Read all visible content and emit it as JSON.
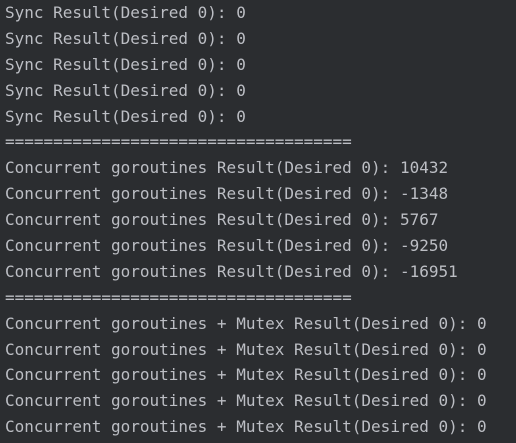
{
  "console": {
    "lines": [
      "Sync Result(Desired 0): 0",
      "Sync Result(Desired 0): 0",
      "Sync Result(Desired 0): 0",
      "Sync Result(Desired 0): 0",
      "Sync Result(Desired 0): 0",
      "====================================",
      "Concurrent goroutines Result(Desired 0): 10432",
      "Concurrent goroutines Result(Desired 0): -1348",
      "Concurrent goroutines Result(Desired 0): 5767",
      "Concurrent goroutines Result(Desired 0): -9250",
      "Concurrent goroutines Result(Desired 0): -16951",
      "====================================",
      "Concurrent goroutines + Mutex Result(Desired 0): 0",
      "Concurrent goroutines + Mutex Result(Desired 0): 0",
      "Concurrent goroutines + Mutex Result(Desired 0): 0",
      "Concurrent goroutines + Mutex Result(Desired 0): 0",
      "Concurrent goroutines + Mutex Result(Desired 0): 0"
    ]
  },
  "colors": {
    "background": "#2b2d30",
    "text": "#bcbec4"
  }
}
